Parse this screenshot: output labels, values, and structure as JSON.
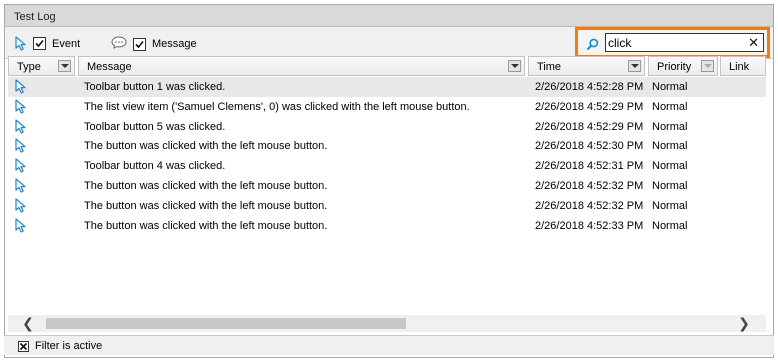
{
  "window": {
    "title": "Test Log"
  },
  "toolbar": {
    "event_label": "Event",
    "event_checked": true,
    "message_label": "Message",
    "message_checked": true,
    "search_value": "click",
    "search_clear": "✕",
    "highlight_color": "#f07d14"
  },
  "columns": {
    "type": "Type",
    "message": "Message",
    "time": "Time",
    "priority": "Priority",
    "link": "Link"
  },
  "rows": [
    {
      "message": "Toolbar button 1 was clicked.",
      "time": "2/26/2018 4:52:28 PM",
      "priority": "Normal"
    },
    {
      "message": "The list view item ('Samuel Clemens', 0) was clicked with the left mouse button.",
      "time": "2/26/2018 4:52:29 PM",
      "priority": "Normal"
    },
    {
      "message": "Toolbar button 5 was clicked.",
      "time": "2/26/2018 4:52:29 PM",
      "priority": "Normal"
    },
    {
      "message": "The button was clicked with the left mouse button.",
      "time": "2/26/2018 4:52:30 PM",
      "priority": "Normal"
    },
    {
      "message": "Toolbar button 4 was clicked.",
      "time": "2/26/2018 4:52:31 PM",
      "priority": "Normal"
    },
    {
      "message": "The button was clicked with the left mouse button.",
      "time": "2/26/2018 4:52:32 PM",
      "priority": "Normal"
    },
    {
      "message": "The button was clicked with the left mouse button.",
      "time": "2/26/2018 4:52:32 PM",
      "priority": "Normal"
    },
    {
      "message": "The button was clicked with the left mouse button.",
      "time": "2/26/2018 4:52:33 PM",
      "priority": "Normal"
    }
  ],
  "status": {
    "text": "Filter is active"
  },
  "icons": {
    "row_type": "cursor-icon",
    "event": "cursor-icon",
    "message": "speech-bubble-icon",
    "search": "search-icon"
  },
  "colors": {
    "cursor": "#1a86d6",
    "selected_row": "#e8e8e8"
  }
}
